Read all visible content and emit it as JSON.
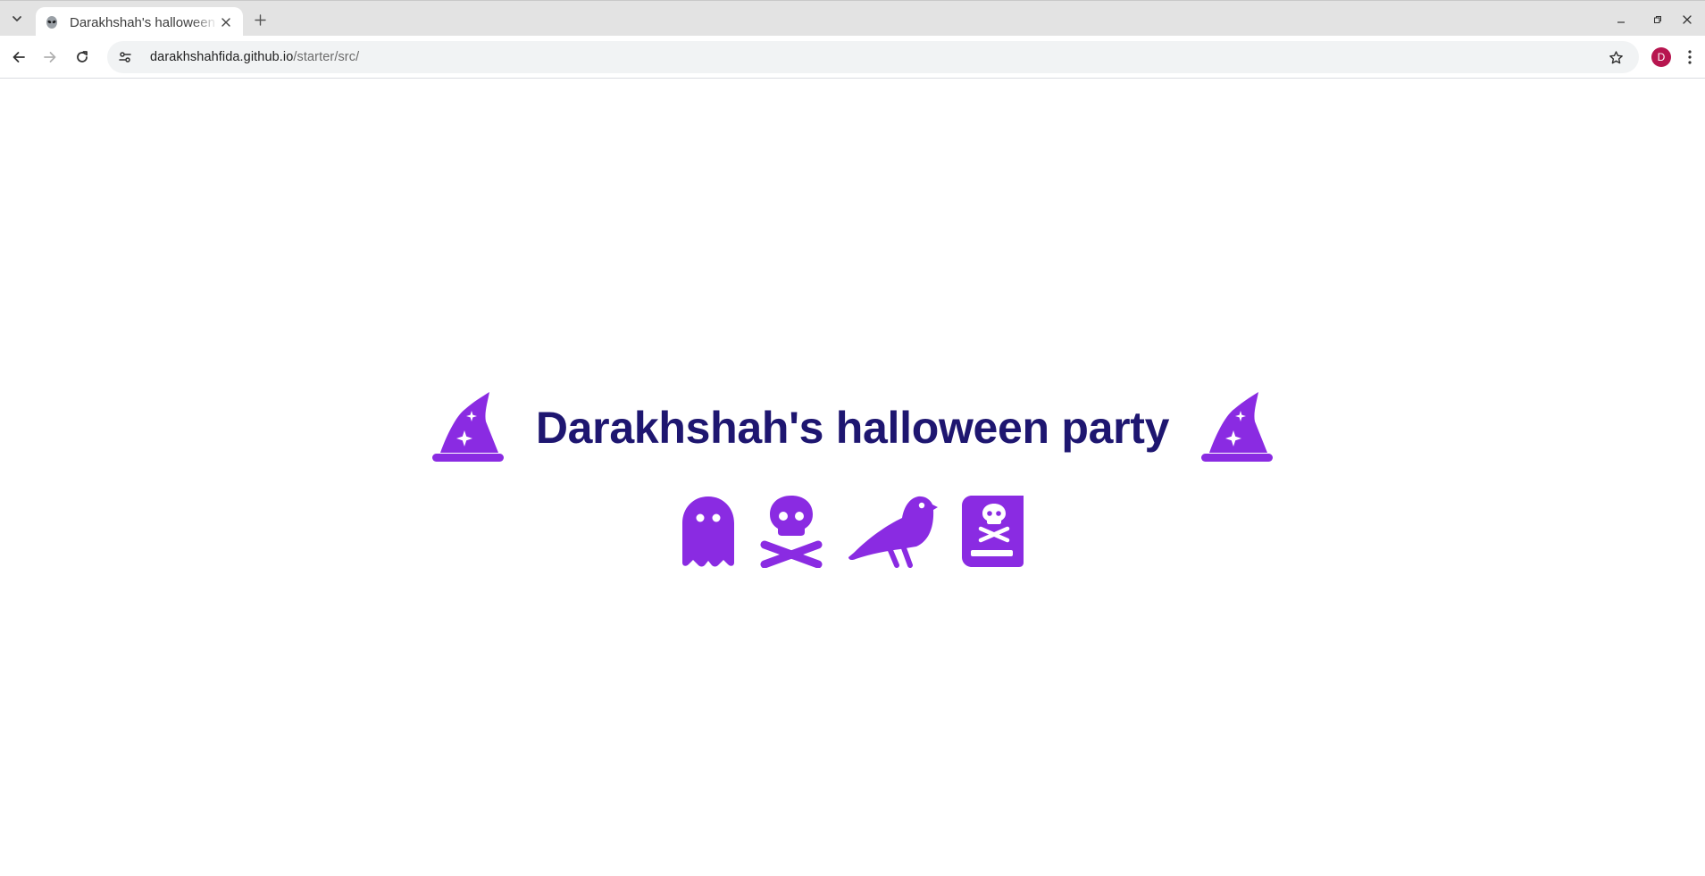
{
  "browser": {
    "tab": {
      "title": "Darakhshah's halloween party",
      "favicon": "alien-icon"
    },
    "address_bar": {
      "host": "darakhshahfida.github.io",
      "path": "/starter/src/"
    },
    "profile_initial": "D",
    "colors": {
      "tabstrip": "#e3e3e3",
      "avatar": "#b7154f"
    }
  },
  "page": {
    "title": "Darakhshah's halloween party",
    "title_color": "#1e1670",
    "icon_color": "#8a2be2",
    "decor_icons": [
      "witch-hat-icon",
      "witch-hat-icon"
    ],
    "icons": [
      "ghost-icon",
      "skull-crossbones-icon",
      "crow-icon",
      "spell-book-icon"
    ]
  }
}
